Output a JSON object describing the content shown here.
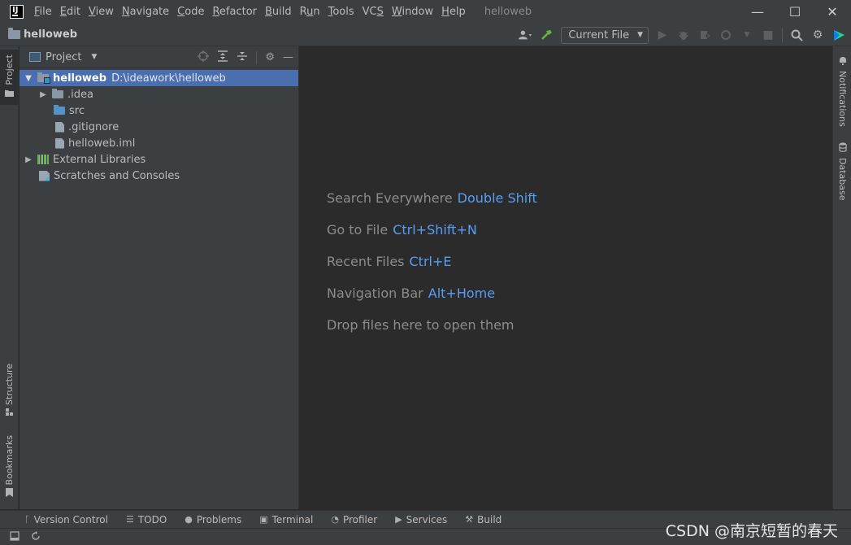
{
  "titlebar": {
    "menu": [
      {
        "label": "File",
        "mnemonic": "F",
        "rest": "ile"
      },
      {
        "label": "Edit",
        "mnemonic": "E",
        "rest": "dit"
      },
      {
        "label": "View",
        "mnemonic": "V",
        "rest": "iew"
      },
      {
        "label": "Navigate",
        "mnemonic": "N",
        "rest": "avigate"
      },
      {
        "label": "Code",
        "mnemonic": "C",
        "rest": "ode"
      },
      {
        "label": "Refactor",
        "mnemonic": "R",
        "rest": "efactor"
      },
      {
        "label": "Build",
        "mnemonic": "B",
        "rest": "uild"
      },
      {
        "label": "Run",
        "mnemonic": "u",
        "pre": "R",
        "rest": "n"
      },
      {
        "label": "Tools",
        "mnemonic": "T",
        "rest": "ools"
      },
      {
        "label": "VCS",
        "mnemonic": "S",
        "pre": "VC",
        "rest": ""
      },
      {
        "label": "Window",
        "mnemonic": "W",
        "rest": "indow"
      },
      {
        "label": "Help",
        "mnemonic": "H",
        "rest": "elp"
      }
    ],
    "window_title": "helloweb",
    "controls": {
      "minimize": "—",
      "maximize": "☐",
      "close": "✕"
    }
  },
  "navbar": {
    "project_name": "helloweb",
    "run_config": "Current File"
  },
  "left_stripe": {
    "project_tab": "Project",
    "structure_tab": "Structure",
    "bookmarks_tab": "Bookmarks"
  },
  "right_stripe": {
    "notifications_tab": "Notifications",
    "database_tab": "Database"
  },
  "project_panel": {
    "title": "Project",
    "tree": [
      {
        "name": "helloweb",
        "path": "D:\\ideawork\\helloweb"
      },
      {
        "name": ".idea"
      },
      {
        "name": "src"
      },
      {
        "name": ".gitignore"
      },
      {
        "name": "helloweb.iml"
      },
      {
        "name": "External Libraries"
      },
      {
        "name": "Scratches and Consoles"
      }
    ]
  },
  "editor": {
    "hints": [
      {
        "label": "Search Everywhere",
        "key": "Double Shift"
      },
      {
        "label": "Go to File",
        "key": "Ctrl+Shift+N"
      },
      {
        "label": "Recent Files",
        "key": "Ctrl+E"
      },
      {
        "label": "Navigation Bar",
        "key": "Alt+Home"
      },
      {
        "label": "Drop files here to open them",
        "key": ""
      }
    ]
  },
  "bottom_tools": [
    {
      "label": "Version Control",
      "icon": "version-control-icon"
    },
    {
      "label": "TODO",
      "icon": "todo-icon"
    },
    {
      "label": "Problems",
      "icon": "problems-icon"
    },
    {
      "label": "Terminal",
      "icon": "terminal-icon"
    },
    {
      "label": "Profiler",
      "icon": "profiler-icon"
    },
    {
      "label": "Services",
      "icon": "services-icon"
    },
    {
      "label": "Build",
      "icon": "build-icon"
    }
  ],
  "watermark": "CSDN @南京短暂的春天"
}
